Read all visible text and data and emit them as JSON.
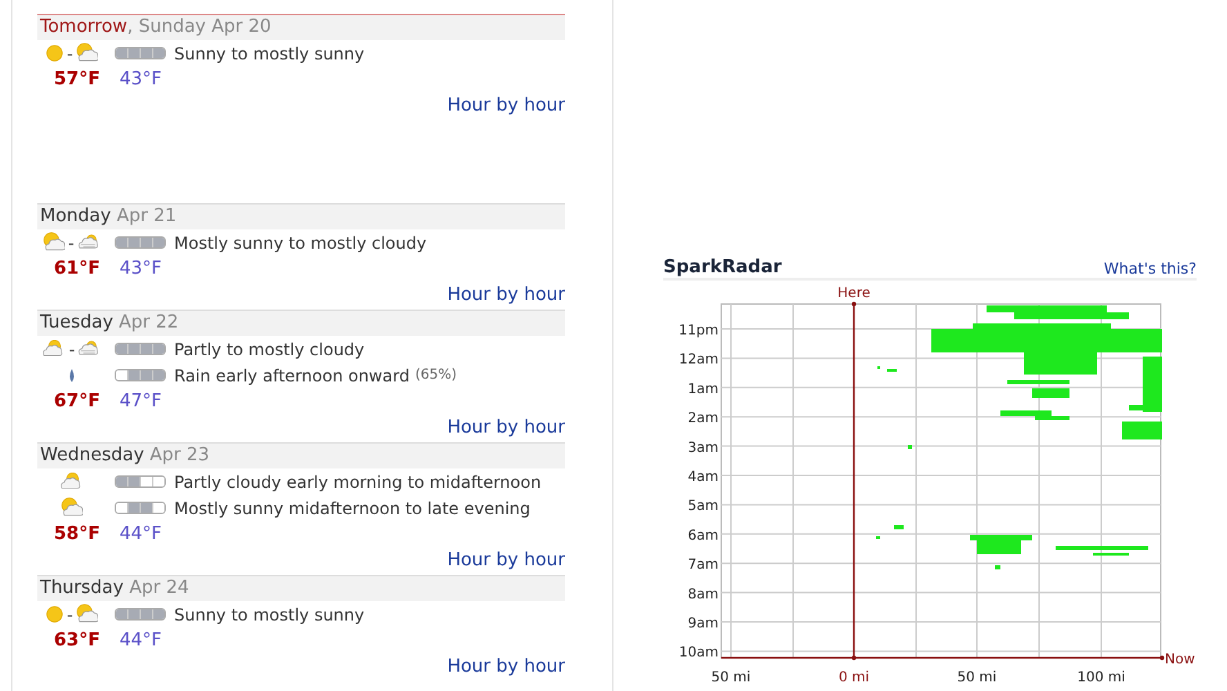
{
  "days": [
    {
      "name": "Tomorrow",
      "date": ", Sunday Apr 20",
      "highlighted": true,
      "conditions": [
        {
          "icons": [
            {
              "kind": "sunny"
            },
            {
              "kind": "mostly_sunny"
            }
          ],
          "separator": "-",
          "segments": [
            true,
            true,
            true,
            true
          ],
          "text": "Sunny to mostly sunny"
        }
      ],
      "high": "57°F",
      "low": "43°F",
      "link": "Hour by hour"
    },
    {
      "name": "Monday",
      "date": " Apr 21",
      "highlighted": false,
      "conditions": [
        {
          "icons": [
            {
              "kind": "mostly_sunny"
            },
            {
              "kind": "mostly_cloudy"
            }
          ],
          "separator": "-",
          "segments": [
            true,
            true,
            true,
            true
          ],
          "text": "Mostly sunny to mostly cloudy"
        }
      ],
      "high": "61°F",
      "low": "43°F",
      "link": "Hour by hour"
    },
    {
      "name": "Tuesday",
      "date": " Apr 22",
      "highlighted": false,
      "conditions": [
        {
          "icons": [
            {
              "kind": "partly_cloudy"
            },
            {
              "kind": "mostly_cloudy"
            }
          ],
          "separator": "-",
          "segments": [
            true,
            true,
            true,
            true
          ],
          "text": "Partly to mostly cloudy"
        },
        {
          "icons": [
            {
              "kind": "rain"
            }
          ],
          "segments": [
            false,
            true,
            true,
            true
          ],
          "text": "Rain early afternoon onward",
          "chance": "(65%)"
        }
      ],
      "high": "67°F",
      "low": "47°F",
      "link": "Hour by hour"
    },
    {
      "name": "Wednesday",
      "date": " Apr 23",
      "highlighted": false,
      "conditions": [
        {
          "icons": [
            {
              "kind": "partly_cloudy"
            }
          ],
          "segments": [
            true,
            true,
            false,
            false
          ],
          "text": "Partly cloudy early morning to midafternoon"
        },
        {
          "icons": [
            {
              "kind": "mostly_sunny"
            }
          ],
          "segments": [
            false,
            true,
            true,
            false
          ],
          "text": "Mostly sunny midafternoon to late evening"
        }
      ],
      "high": "58°F",
      "low": "44°F",
      "link": "Hour by hour"
    },
    {
      "name": "Thursday",
      "date": " Apr 24",
      "highlighted": false,
      "conditions": [
        {
          "icons": [
            {
              "kind": "sunny"
            },
            {
              "kind": "mostly_sunny"
            }
          ],
          "separator": "-",
          "segments": [
            true,
            true,
            true,
            true
          ],
          "text": "Sunny to mostly sunny"
        }
      ],
      "high": "63°F",
      "low": "44°F",
      "link": "Hour by hour"
    }
  ],
  "radar": {
    "title": "SparkRadar",
    "help_link": "What's this?",
    "here_label": "Here",
    "now_label": "Now",
    "time_labels": [
      "11pm",
      "12am",
      "1am",
      "2am",
      "3am",
      "4am",
      "5am",
      "6am",
      "7am",
      "8am",
      "9am",
      "10am"
    ],
    "distance_labels": [
      "50 mi",
      "0 mi",
      "50 mi",
      "100 mi"
    ]
  }
}
